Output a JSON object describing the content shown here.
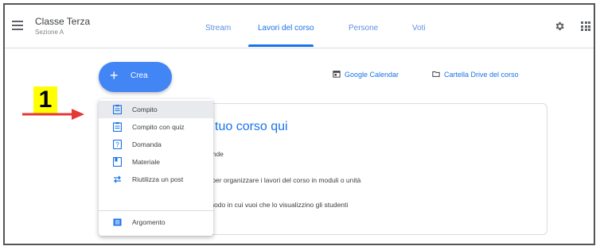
{
  "header": {
    "class_title": "Classe Terza",
    "class_subtitle": "Sezione A",
    "tabs": [
      {
        "label": "Stream"
      },
      {
        "label": "Lavori del corso"
      },
      {
        "label": "Persone"
      },
      {
        "label": "Voti"
      }
    ],
    "active_tab": "Lavori del corso"
  },
  "toolbar": {
    "create_label": "Crea",
    "google_calendar": "Google Calendar",
    "drive_folder": "Cartella Drive del corso"
  },
  "menu": {
    "items": [
      {
        "label": "Compito",
        "icon": "assignment-icon",
        "selected": true
      },
      {
        "label": "Compito con quiz",
        "icon": "quiz-assignment-icon"
      },
      {
        "label": "Domanda",
        "icon": "question-icon"
      },
      {
        "label": "Materiale",
        "icon": "material-icon"
      },
      {
        "label": "Riutilizza un post",
        "icon": "reuse-icon"
      },
      {
        "label": "Argomento",
        "icon": "topic-icon"
      }
    ]
  },
  "card": {
    "title": "l tuo corso qui",
    "lines": [
      "ande",
      "i per organizzare i lavori del corso in moduli o unità",
      "modo in cui vuoi che lo visualizzino gli studenti"
    ]
  },
  "annotation": {
    "number": "1",
    "badge_color": "#ffff00",
    "arrow_color": "#e53935"
  },
  "colors": {
    "accent": "#1a73e8",
    "create_button": "#4285f4"
  }
}
